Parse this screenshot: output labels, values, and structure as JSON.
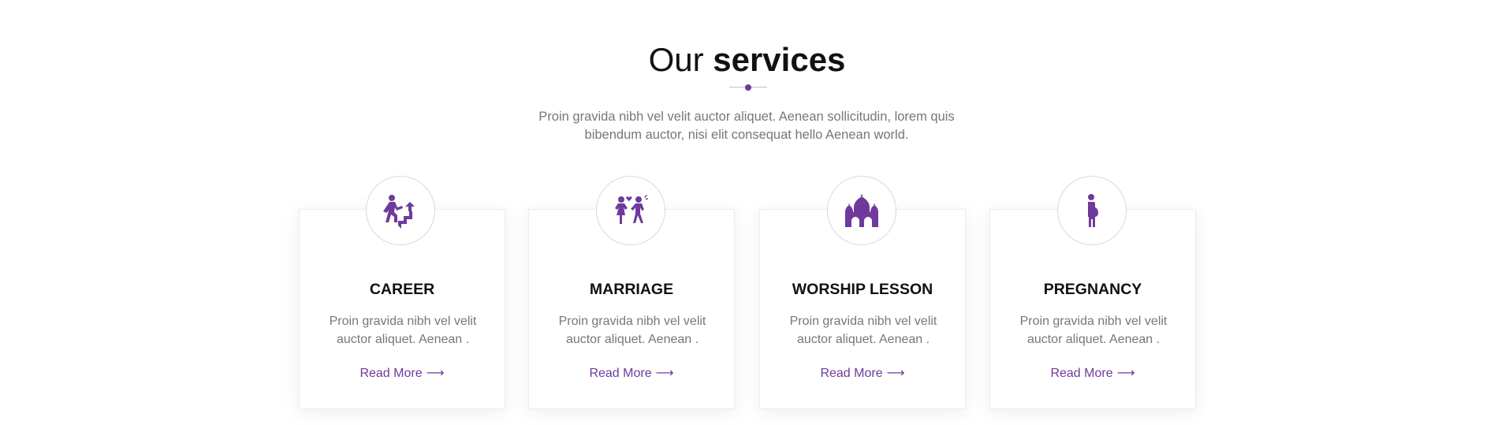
{
  "section": {
    "title_light": "Our",
    "title_bold": "services",
    "intro": "Proin gravida nibh vel velit auctor aliquet. Aenean sollicitudin, lorem quis bibendum auctor, nisi elit consequat hello Aenean world."
  },
  "colors": {
    "accent": "#6e3a9c",
    "text_muted": "#777777",
    "heading": "#111111"
  },
  "services": [
    {
      "title": "CAREER",
      "text": "Proin gravida nibh vel velit auctor aliquet. Aenean .",
      "link": "Read More",
      "link_arrow": "⟶",
      "icon": "career-stairs-icon"
    },
    {
      "title": "MARRIAGE",
      "text": "Proin gravida nibh vel velit auctor aliquet. Aenean .",
      "link": "Read More",
      "link_arrow": "⟶",
      "icon": "marriage-couple-icon"
    },
    {
      "title": "WORSHIP LESSON",
      "text": "Proin gravida nibh vel velit auctor aliquet. Aenean .",
      "link": "Read More",
      "link_arrow": "⟶",
      "icon": "temple-icon"
    },
    {
      "title": "PREGNANCY",
      "text": "Proin gravida nibh vel velit auctor aliquet. Aenean .",
      "link": "Read More",
      "link_arrow": "⟶",
      "icon": "pregnant-woman-icon"
    }
  ]
}
